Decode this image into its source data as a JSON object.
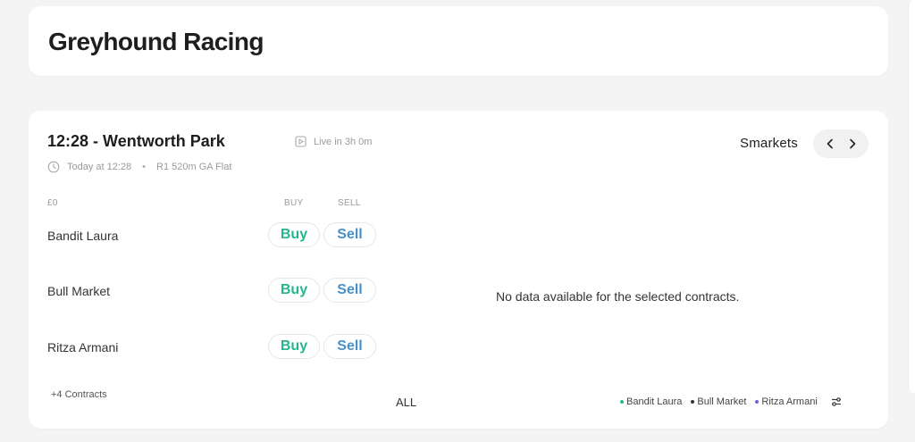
{
  "page": {
    "title": "Greyhound Racing"
  },
  "event": {
    "title": "12:28 - Wentworth Park",
    "live_status": "Live in 3h 0m",
    "time": "Today at 12:28",
    "race_info": "R1 520m GA Flat",
    "brand": "Smarkets"
  },
  "table": {
    "stake": "£0",
    "buy_header": "BUY",
    "sell_header": "SELL",
    "buy_label": "Buy",
    "sell_label": "Sell",
    "runners": [
      {
        "name": "Bandit Laura"
      },
      {
        "name": "Bull Market"
      },
      {
        "name": "Ritza Armani"
      }
    ],
    "more_contracts": "+4 Contracts"
  },
  "chart": {
    "empty_message": "No data available for the selected contracts.",
    "range_label": "ALL",
    "legend": [
      {
        "name": "Bandit Laura",
        "color": "#26b68f"
      },
      {
        "name": "Bull Market",
        "color": "#333333"
      },
      {
        "name": "Ritza Armani",
        "color": "#7b5cd6"
      }
    ]
  },
  "icons": {
    "live": "play-square-icon",
    "time": "clock-icon",
    "prev": "chevron-left-icon",
    "next": "chevron-right-icon",
    "settings": "sliders-icon"
  }
}
